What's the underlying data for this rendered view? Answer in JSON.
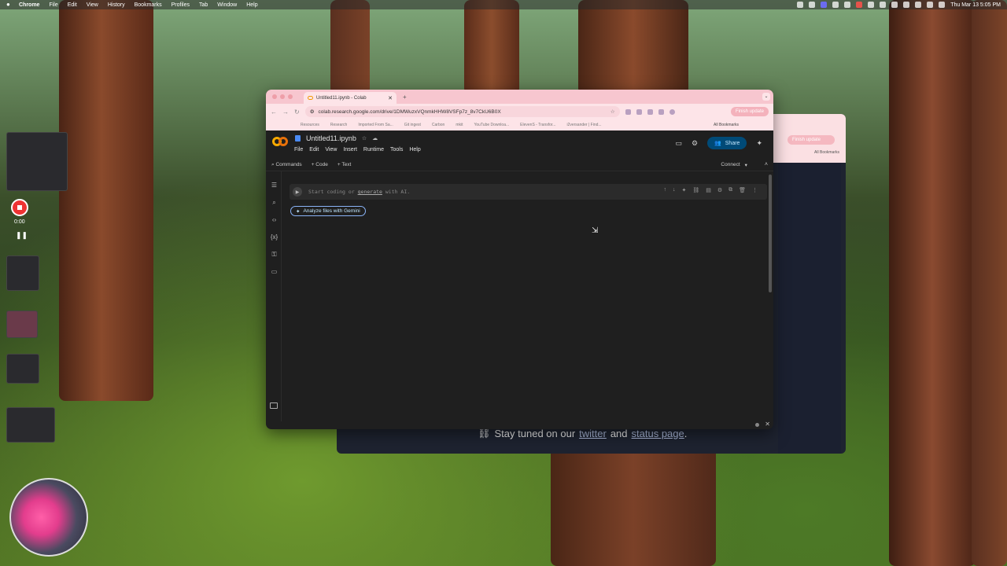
{
  "menubar": {
    "app": "Chrome",
    "items": [
      "File",
      "Edit",
      "View",
      "History",
      "Bookmarks",
      "Profiles",
      "Tab",
      "Window",
      "Help"
    ],
    "datetime": "Thu Mar 13  5:05 PM"
  },
  "recorder": {
    "time": "0:00"
  },
  "browser": {
    "tab_title": "Untitled11.ipynb - Colab",
    "url": "colab.research.google.com/drive/1DMWuzxVQnmkHHW8VSFp7z_8v7CkU6B0X",
    "finish_update": "Finish update",
    "bookmarks": [
      "Resources",
      "Research",
      "Imported From Sa...",
      "Git ingest",
      "Carbon",
      "mkit",
      "YouTube Downloa...",
      "ElevenS - Transfor...",
      "i2versander | Find..."
    ],
    "all_bookmarks": "All Bookmarks"
  },
  "colab": {
    "notebook_title": "Untitled11.ipynb",
    "menu": [
      "File",
      "Edit",
      "View",
      "Insert",
      "Runtime",
      "Tools",
      "Help"
    ],
    "share_label": "Share",
    "toolbar": {
      "commands": "Commands",
      "code": "+ Code",
      "text": "+ Text",
      "connect": "Connect"
    },
    "cell_placeholder_prefix": "Start coding or ",
    "cell_placeholder_link": "generate",
    "cell_placeholder_suffix": " with AI.",
    "gemini_button": "Analyze files with Gemini"
  },
  "background_window": {
    "finish_update": "Finish update",
    "all_bookmarks": "All Bookmarks",
    "status_prefix": "Stay tuned on our",
    "twitter": "twitter",
    "and": "and",
    "status_page": "status page",
    "status_suffix": "."
  }
}
